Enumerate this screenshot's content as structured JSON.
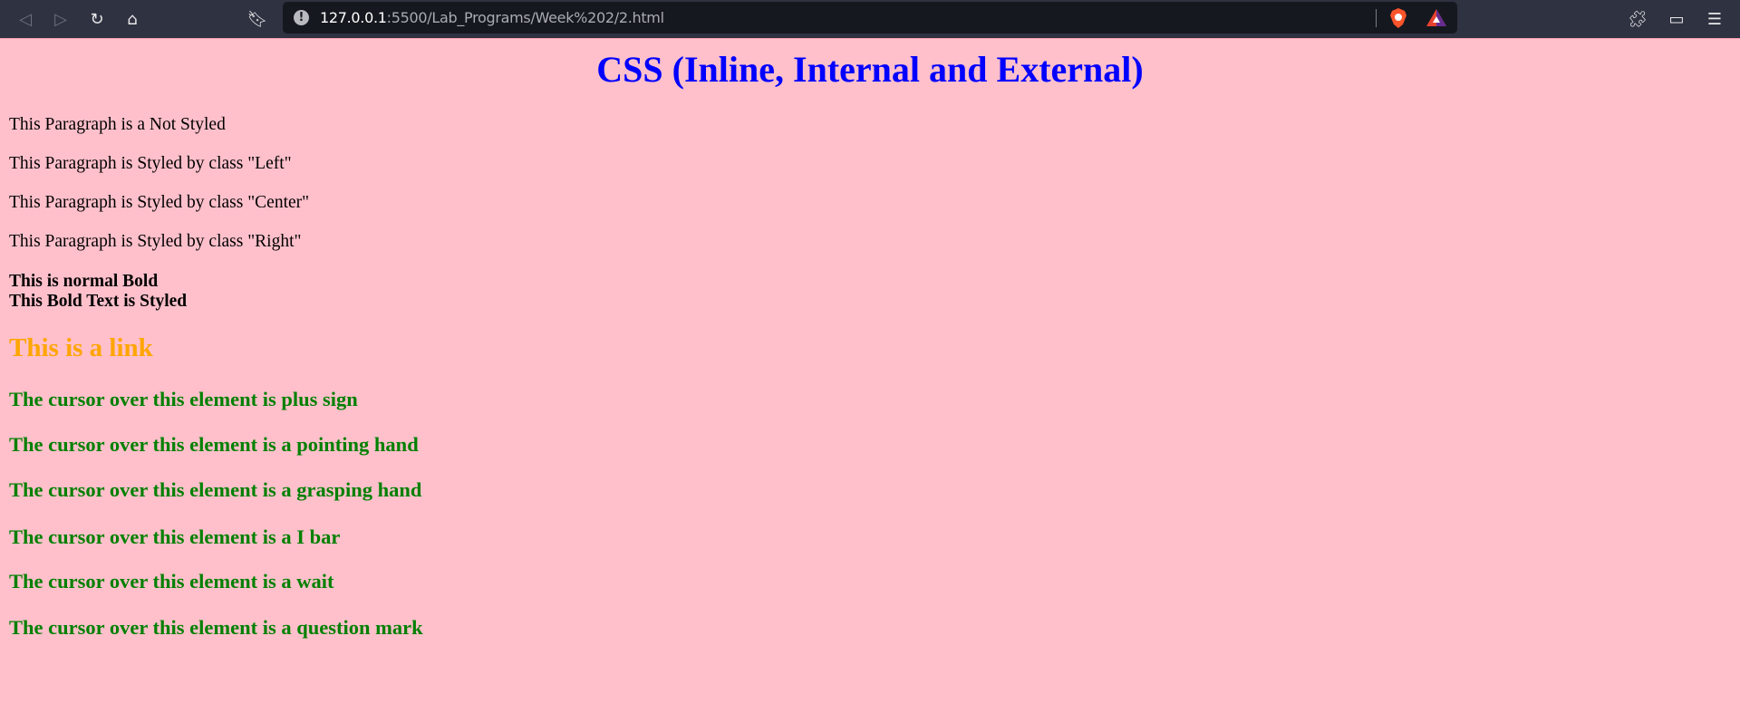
{
  "browser": {
    "url_host": "127.0.0.1",
    "url_rest": ":5500/Lab_Programs/Week%202/2.html"
  },
  "page": {
    "title": "CSS (Inline, Internal and External)",
    "paragraphs": [
      "This Paragraph is a Not Styled",
      "This Paragraph is Styled by class \"Left\"",
      "This Paragraph is Styled by class \"Center\"",
      "This Paragraph is Styled by class \"Right\""
    ],
    "bold_normal": "This is normal Bold",
    "bold_styled": "This Bold Text is Styled",
    "link": "This is a link",
    "cursor_items": [
      "The cursor over this element is plus sign",
      "The cursor over this element is a pointing hand",
      "The cursor over this element is a grasping hand",
      "The cursor over this element is a I bar",
      "The cursor over this element is a wait",
      "The cursor over this element is a question mark"
    ]
  },
  "colors": {
    "background": "#ffc0cb",
    "title": "#0000ff",
    "link": "#ffa500",
    "cursor_text": "#008000"
  }
}
